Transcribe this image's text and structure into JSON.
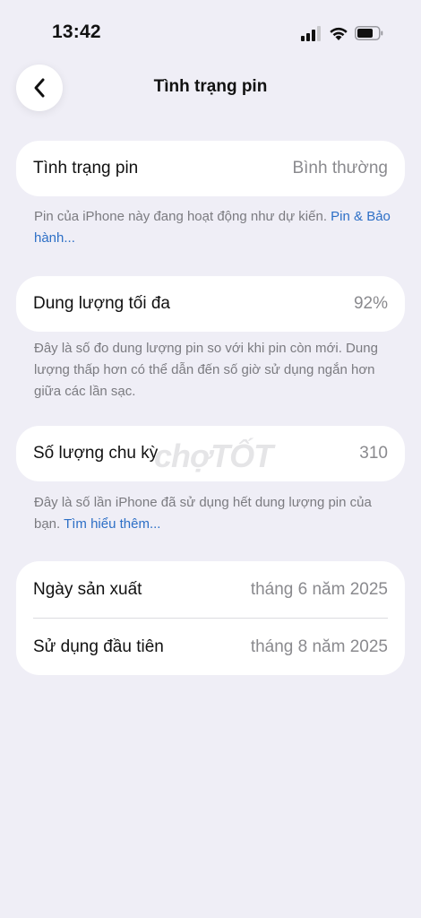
{
  "status_bar": {
    "time": "13:42"
  },
  "nav": {
    "title": "Tình trạng pin"
  },
  "battery_health": {
    "label": "Tình trạng pin",
    "value": "Bình thường",
    "footnote_text": "Pin của iPhone này đang hoạt động như dự kiến. ",
    "footnote_link": "Pin & Bảo hành..."
  },
  "max_capacity": {
    "label": "Dung lượng tối đa",
    "value": "92%",
    "footnote_text": "Đây là số đo dung lượng pin so với khi pin còn mới. Dung lượng thấp hơn có thể dẫn đến số giờ sử dụng ngắn hơn giữa các lần sạc."
  },
  "cycle_count": {
    "label": "Số lượng chu kỳ",
    "value": "310",
    "footnote_text": "Đây là số lần iPhone đã sử dụng hết dung lượng pin của bạn. ",
    "footnote_link": "Tìm hiểu thêm..."
  },
  "dates": {
    "manufacture_label": "Ngày sản xuất",
    "manufacture_value": "tháng 6 năm 2025",
    "first_use_label": "Sử dụng đầu tiên",
    "first_use_value": "tháng 8 năm 2025"
  },
  "watermark": "chợTỐT",
  "colors": {
    "background": "#efeef6",
    "link": "#2d6fc6",
    "secondary_text": "#8a8a8e"
  }
}
